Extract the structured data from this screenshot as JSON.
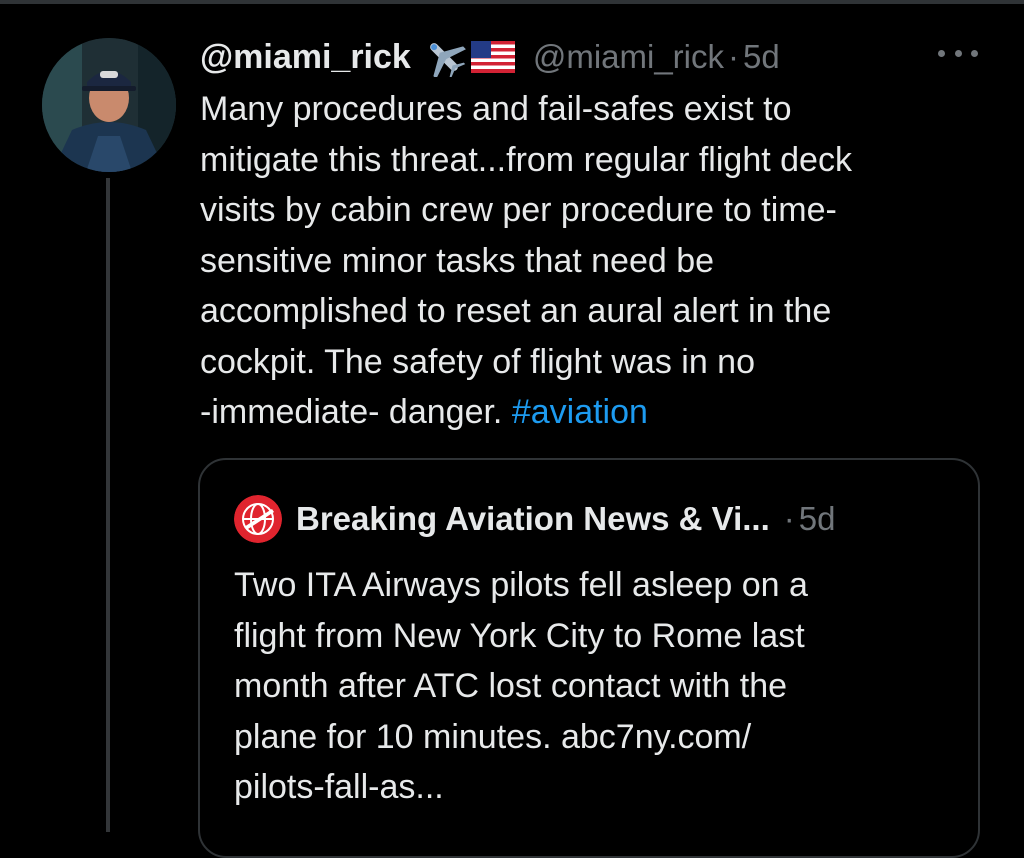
{
  "tweet": {
    "display_name": "@miami_rick",
    "emoji_icons": [
      "airplane-icon",
      "us-flag-icon"
    ],
    "handle": "@miami_rick",
    "separator": "·",
    "timestamp": "5d",
    "body_lines": [
      "Many procedures and fail-safes exist to",
      "mitigate this threat...from regular flight deck",
      "visits by cabin crew per procedure to time-",
      "sensitive minor tasks that need be",
      "accomplished to reset an aural alert in the",
      "cockpit. The safety of flight was in no",
      "-immediate- danger."
    ],
    "hashtag": "#aviation"
  },
  "quote": {
    "display_name": "Breaking Aviation News & Vi...",
    "separator": "·",
    "timestamp": "5d",
    "body_lines": [
      "Two ITA Airways pilots fell asleep on a",
      "flight from New York City to Rome last",
      "month after ATC lost contact with the",
      "plane for 10 minutes. abc7ny.com/",
      "pilots-fall-as..."
    ]
  },
  "colors": {
    "background": "#000000",
    "text": "#e7e9ea",
    "muted": "#71767b",
    "link": "#1d9bf0",
    "border": "#2f3336"
  }
}
